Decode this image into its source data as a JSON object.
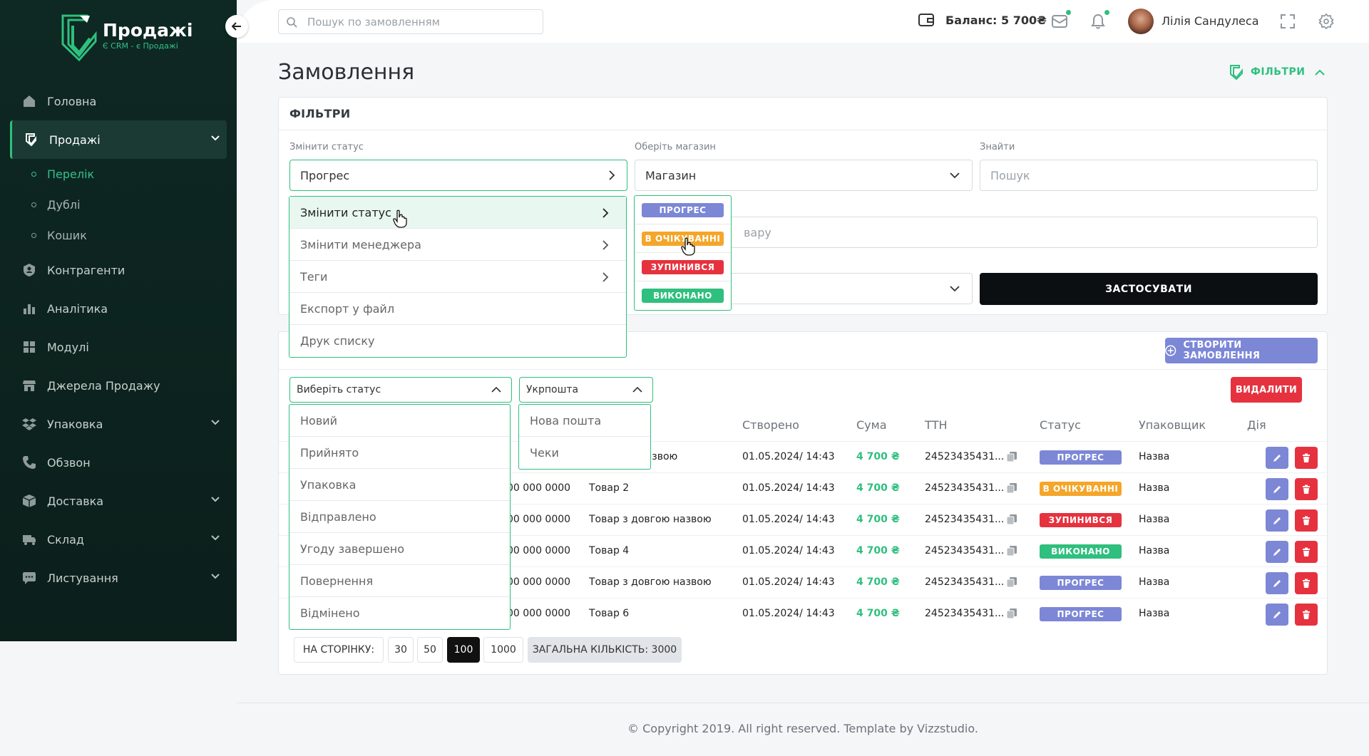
{
  "brand": {
    "title": "Продажі",
    "subtitle": "Є CRM - є Продажі"
  },
  "sidebar": {
    "items": [
      {
        "label": "Головна",
        "icon": "home-icon"
      },
      {
        "label": "Продажі",
        "icon": "sales-icon",
        "active": true
      },
      {
        "label": "Контрагенти",
        "icon": "contractors-icon"
      },
      {
        "label": "Аналітика",
        "icon": "analytics-icon"
      },
      {
        "label": "Модулі",
        "icon": "modules-icon"
      },
      {
        "label": "Джерела Продажу",
        "icon": "store-icon"
      },
      {
        "label": "Упаковка",
        "icon": "dropbox-icon"
      },
      {
        "label": "Обзвон",
        "icon": "phone-icon"
      },
      {
        "label": "Доставка",
        "icon": "delivery-box-icon"
      },
      {
        "label": "Склад",
        "icon": "warehouse-truck-icon"
      },
      {
        "label": "Листування",
        "icon": "chat-icon"
      }
    ],
    "sub_items": [
      {
        "label": "Перелік",
        "active": true
      },
      {
        "label": "Дублі"
      },
      {
        "label": "Кошик"
      }
    ]
  },
  "topbar": {
    "search_placeholder": "Пошук по замовленням",
    "balance": "Баланс: 5 700₴",
    "user_name": "Лілія Сандулеса"
  },
  "page": {
    "title": "Замовлення",
    "filters_toggle": "ФІЛЬТРИ"
  },
  "filters": {
    "header": "ФІЛЬТРИ",
    "change_status_label": "Змінити статус",
    "change_status_value": "Прогрес",
    "store_label": "Оберіть магазин",
    "store_value": "Магазин",
    "find_label": "Знайти",
    "find_placeholder": "Пошук",
    "product_placeholder_tail": "вару",
    "apply": "ЗАСТОСУВАТИ"
  },
  "actions_menu": [
    {
      "label": "Змінити статус",
      "arrow": true,
      "highlighted": true
    },
    {
      "label": "Змінити менеджера",
      "arrow": true
    },
    {
      "label": "Теги",
      "arrow": true
    },
    {
      "label": "Експорт у файл"
    },
    {
      "label": "Друк списку"
    }
  ],
  "status_menu": [
    {
      "label": "ПРОГРЕС",
      "color": "#7c87d6"
    },
    {
      "label": "В ОЧІКУВАННІ",
      "color": "#f4a62a"
    },
    {
      "label": "ЗУПИНИВСЯ",
      "color": "#e6323f"
    },
    {
      "label": "ВИКОНАНО",
      "color": "#2fbf7e"
    }
  ],
  "orders": {
    "create_button": "СТВОРИТИ ЗАМОВЛЕННЯ",
    "status_select": "Виберіть статус",
    "delivery_select": "Укрпошта",
    "delete_button": "ВИДАЛИТИ",
    "columns": [
      "Створено",
      "Сума",
      "ТТН",
      "Статус",
      "Упаковщик",
      "Дія"
    ],
    "rows": [
      {
        "phone": "",
        "product": "з довгою назвою",
        "created": "01.05.2024/ 14:43",
        "sum": "4 700 ₴",
        "ttn": "24523435431...",
        "status": "ПРОГРЕС",
        "status_color": "#7c87d6",
        "packer": "Назва"
      },
      {
        "phone": "00 000 0000",
        "product": "Товар 2",
        "created": "01.05.2024/ 14:43",
        "sum": "4 700 ₴",
        "ttn": "24523435431...",
        "status": "В ОЧІКУВАННІ",
        "status_color": "#f4a62a",
        "packer": "Назва"
      },
      {
        "phone": "00 000 0000",
        "product": "Товар з довгою назвою",
        "created": "01.05.2024/ 14:43",
        "sum": "4 700 ₴",
        "ttn": "24523435431...",
        "status": "ЗУПИНИВСЯ",
        "status_color": "#e6323f",
        "packer": "Назва"
      },
      {
        "phone": "00 000 0000",
        "product": "Товар 4",
        "created": "01.05.2024/ 14:43",
        "sum": "4 700 ₴",
        "ttn": "24523435431...",
        "status": "ВИКОНАНО",
        "status_color": "#2fbf7e",
        "packer": "Назва"
      },
      {
        "phone": "00 000 0000",
        "product": "Товар з довгою назвою",
        "created": "01.05.2024/ 14:43",
        "sum": "4 700 ₴",
        "ttn": "24523435431...",
        "status": "ПРОГРЕС",
        "status_color": "#7c87d6",
        "packer": "Назва"
      },
      {
        "phone": "00 000 0000",
        "product": "Товар 6",
        "created": "01.05.2024/ 14:43",
        "sum": "4 700 ₴",
        "ttn": "24523435431...",
        "status": "ПРОГРЕС",
        "status_color": "#7c87d6",
        "packer": "Назва"
      }
    ],
    "status_options": [
      "Новий",
      "Прийнято",
      "Упаковка",
      "Відправлено",
      "Угоду завершено",
      "Повернення",
      "Відмінено"
    ],
    "delivery_options": [
      "Нова пошта",
      "Чеки"
    ]
  },
  "pagination": {
    "per_page_label": "НА СТОРІНКУ:",
    "options": [
      "30",
      "50",
      "100",
      "1000"
    ],
    "active": "100",
    "total": "ЗАГАЛЬНА КІЛЬКІСТЬ: 3000"
  },
  "footer": "© Copyright 2019. All right reserved. Template by Vizzstudio.",
  "colors": {
    "accent": "#2fbf7e",
    "primary": "#7c87d6",
    "danger": "#e6323f",
    "warning": "#f4a62a",
    "sidebar_bg": "#0e2823"
  }
}
